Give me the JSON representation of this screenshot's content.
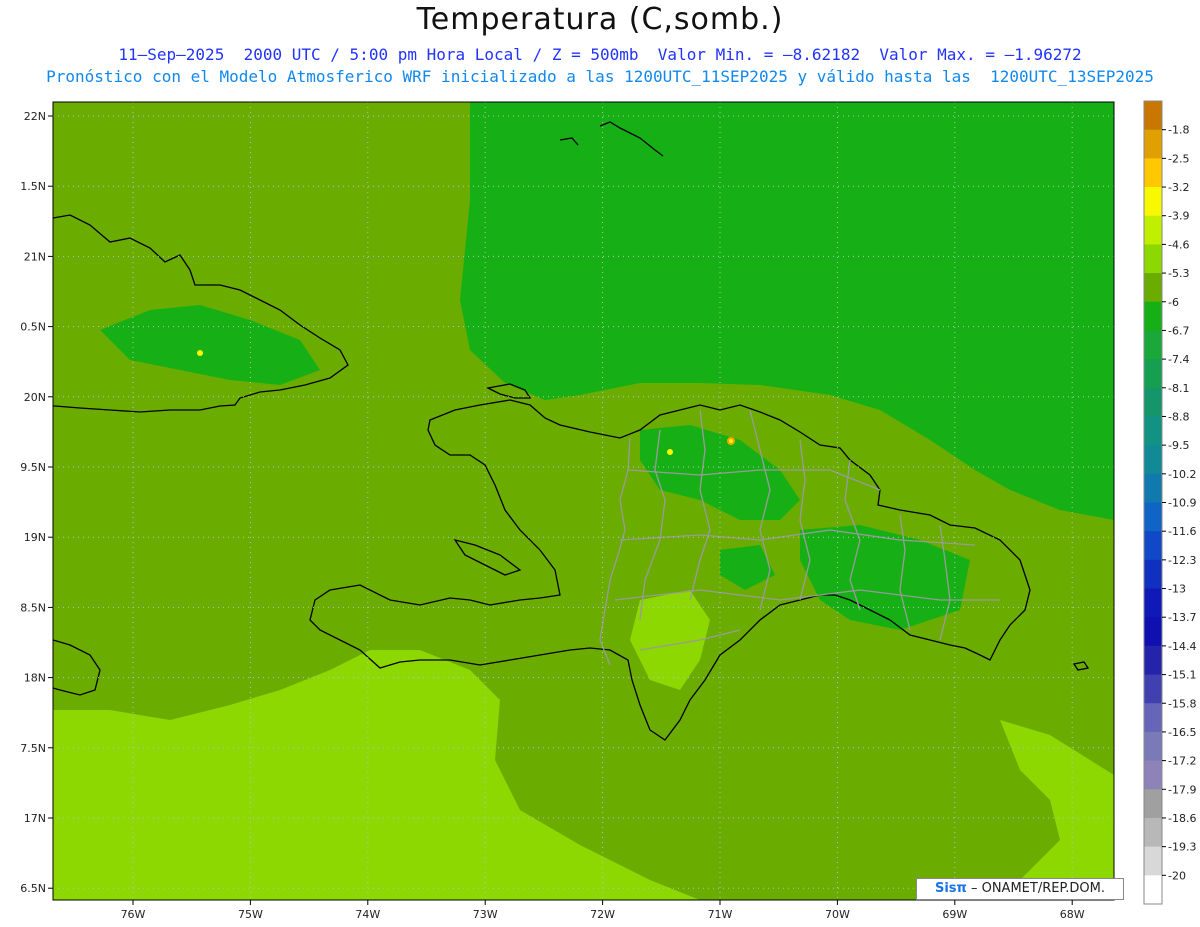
{
  "header": {
    "title": "Temperatura (C,somb.)",
    "subtitle1": "11–Sep–2025  2000 UTC / 5:00 pm Hora Local / Z = 500mb  Valor Min. = –8.62182  Valor Max. = –1.96272",
    "subtitle2": "Pronóstico con el Modelo Atmosferico WRF inicializado a las 1200UTC_11SEP2025 y válido hasta las  1200UTC_13SEP2025"
  },
  "axes": {
    "lat_labels": [
      "22N",
      "1.5N",
      "21N",
      "0.5N",
      "20N",
      "9.5N",
      "19N",
      "8.5N",
      "18N",
      "7.5N",
      "17N",
      "6.5N"
    ],
    "lat_values": [
      22,
      21.5,
      21,
      20.5,
      20,
      19.5,
      19,
      18.5,
      18,
      17.5,
      17,
      16.5
    ],
    "lon_labels": [
      "76W",
      "75W",
      "74W",
      "73W",
      "72W",
      "71W",
      "70W",
      "69W",
      "68W"
    ],
    "lon_values": [
      -76,
      -75,
      -74,
      -73,
      -72,
      -71,
      -70,
      -69,
      -68
    ]
  },
  "colorbar": {
    "labels": [
      "-1.8",
      "-2.5",
      "-3.2",
      "-3.9",
      "-4.6",
      "-5.3",
      "-6",
      "-6.7",
      "-7.4",
      "-8.1",
      "-8.8",
      "-9.5",
      "-10.2",
      "-10.9",
      "-11.6",
      "-12.3",
      "-13",
      "-13.7",
      "-14.4",
      "-15.1",
      "-15.8",
      "-16.5",
      "-17.2",
      "-17.9",
      "-18.6",
      "-19.3",
      "-20"
    ],
    "colors": [
      "#c87800",
      "#e0a000",
      "#ffc800",
      "#f8f800",
      "#c0f000",
      "#8cd800",
      "#6aac00",
      "#16b016",
      "#1aa83a",
      "#14a050",
      "#14966a",
      "#129282",
      "#118a96",
      "#107aae",
      "#1064c6",
      "#1048c8",
      "#1030c0",
      "#1018b8",
      "#1010b0",
      "#2424aa",
      "#4040b0",
      "#6666b8",
      "#7a7ab8",
      "#8f82b8",
      "#a0a0a0",
      "#b8b8b8",
      "#d8d8d8",
      "#ffffff"
    ]
  },
  "field_colors": {
    "light": "#8cd800",
    "mid": "#6aac00",
    "deep": "#16b016",
    "spot_yellow": "#f8f800",
    "spot_orange": "#ffa000"
  },
  "credit": {
    "brand": "Sisπ",
    "text": "– ONAMET/REP.DOM."
  }
}
